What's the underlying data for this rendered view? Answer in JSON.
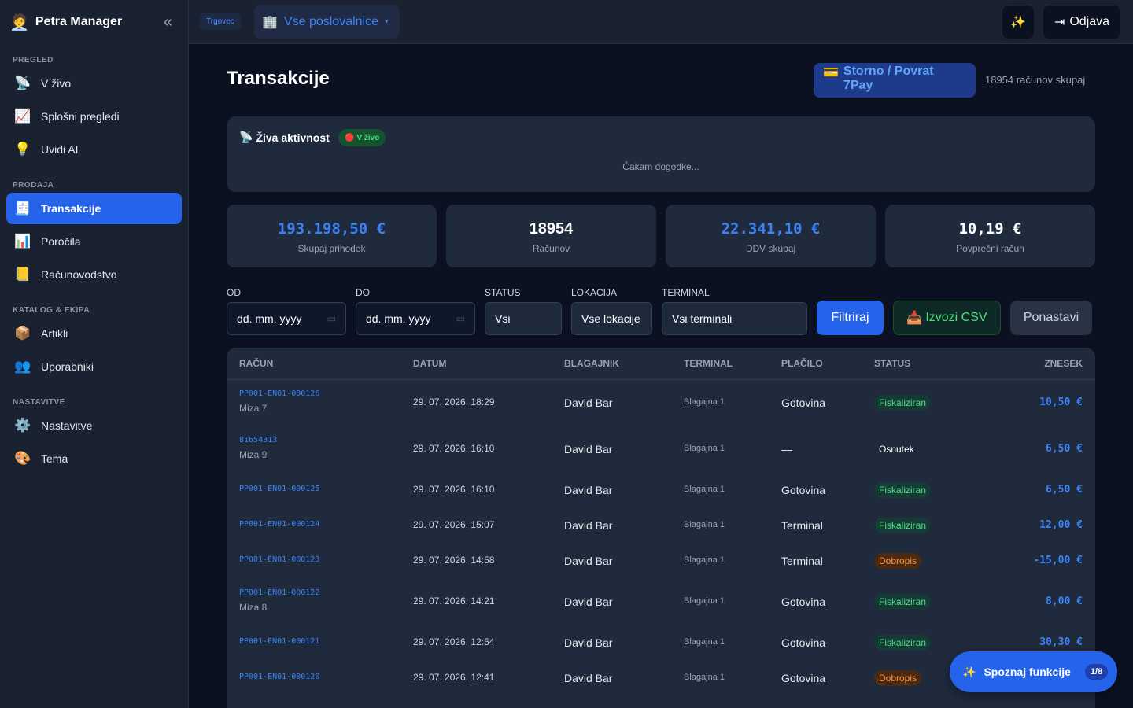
{
  "app": {
    "name": "Petra Manager",
    "logo_icon": "🧑‍💼"
  },
  "sidebar": {
    "sections": [
      {
        "title": "PREGLED",
        "items": [
          {
            "label": "V živo",
            "icon": "📡"
          },
          {
            "label": "Splošni pregledi",
            "icon": "📈"
          },
          {
            "label": "Uvidi AI",
            "icon": "💡"
          }
        ]
      },
      {
        "title": "PRODAJA",
        "items": [
          {
            "label": "Transakcije",
            "icon": "🧾",
            "active": true
          },
          {
            "label": "Poročila",
            "icon": "📊"
          },
          {
            "label": "Računovodstvo",
            "icon": "📒"
          }
        ]
      },
      {
        "title": "KATALOG & EKIPA",
        "items": [
          {
            "label": "Artikli",
            "icon": "📦"
          },
          {
            "label": "Uporabniki",
            "icon": "👥"
          }
        ]
      },
      {
        "title": "NASTAVITVE",
        "items": [
          {
            "label": "Nastavitve",
            "icon": "⚙️"
          },
          {
            "label": "Tema",
            "icon": "🎨"
          }
        ]
      }
    ]
  },
  "topbar": {
    "role": "Trgovec",
    "location": "Vse poslovalnice",
    "location_icon": "🏢",
    "logout_label": "Odjava"
  },
  "page": {
    "title": "Transakcije",
    "storno_label": "Storno / Povrat 7Pay",
    "storno_icon": "💳",
    "count_text": "18954 računov skupaj"
  },
  "live": {
    "title": "Živa aktivnost",
    "badge": "V živo",
    "waiting": "Čakam dogodke..."
  },
  "stats": [
    {
      "value": "193.198,50 €",
      "label": "Skupaj prihodek"
    },
    {
      "value": "18954",
      "label": "Računov"
    },
    {
      "value": "22.341,10 €",
      "label": "DDV skupaj"
    },
    {
      "value": "10,19 €",
      "label": "Povprečni račun"
    }
  ],
  "filters": {
    "od_label": "OD",
    "od_placeholder": "dd. mm. yyyy",
    "do_label": "DO",
    "do_placeholder": "dd. mm. yyyy",
    "status_label": "STATUS",
    "status_value": "Vsi",
    "lokacija_label": "LOKACIJA",
    "lokacija_value": "Vse lokacije",
    "terminal_label": "TERMINAL",
    "terminal_value": "Vsi terminali",
    "filter_btn": "Filtriraj",
    "csv_btn": "Izvozi CSV",
    "reset_btn": "Ponastavi"
  },
  "table": {
    "headers": [
      "RAČUN",
      "DATUM",
      "BLAGAJNIK",
      "TERMINAL",
      "PLAČILO",
      "STATUS",
      "ZNESEK"
    ],
    "rows": [
      {
        "id": "PP001-EN01-000126",
        "sub": "Miza 7",
        "date": "29. 07. 2026, 18:29",
        "cashier": "David Bar",
        "terminal": "Blagajna 1",
        "payment": "Gotovina",
        "status": "Fiskaliziran",
        "amount": "10,50 €"
      },
      {
        "id": "81654313",
        "sub": "Miza 9",
        "date": "29. 07. 2026, 16:10",
        "cashier": "David Bar",
        "terminal": "Blagajna 1",
        "payment": "—",
        "status": "Osnutek",
        "amount": "6,50 €"
      },
      {
        "id": "PP001-EN01-000125",
        "sub": "",
        "date": "29. 07. 2026, 16:10",
        "cashier": "David Bar",
        "terminal": "Blagajna 1",
        "payment": "Gotovina",
        "status": "Fiskaliziran",
        "amount": "6,50 €"
      },
      {
        "id": "PP001-EN01-000124",
        "sub": "",
        "date": "29. 07. 2026, 15:07",
        "cashier": "David Bar",
        "terminal": "Blagajna 1",
        "payment": "Terminal",
        "status": "Fiskaliziran",
        "amount": "12,00 €"
      },
      {
        "id": "PP001-EN01-000123",
        "sub": "",
        "date": "29. 07. 2026, 14:58",
        "cashier": "David Bar",
        "terminal": "Blagajna 1",
        "payment": "Terminal",
        "status": "Dobropis",
        "amount": "-15,00 €"
      },
      {
        "id": "PP001-EN01-000122",
        "sub": "Miza 8",
        "date": "29. 07. 2026, 14:21",
        "cashier": "David Bar",
        "terminal": "Blagajna 1",
        "payment": "Gotovina",
        "status": "Fiskaliziran",
        "amount": "8,00 €"
      },
      {
        "id": "PP001-EN01-000121",
        "sub": "",
        "date": "29. 07. 2026, 12:54",
        "cashier": "David Bar",
        "terminal": "Blagajna 1",
        "payment": "Gotovina",
        "status": "Fiskaliziran",
        "amount": "30,30 €"
      },
      {
        "id": "PP001-EN01-000120",
        "sub": "",
        "date": "29. 07. 2026, 12:41",
        "cashier": "David Bar",
        "terminal": "Blagajna 1",
        "payment": "Gotovina",
        "status": "Dobropis",
        "amount": ""
      }
    ]
  },
  "tour": {
    "label": "Spoznaj funkcije",
    "step": "1/8",
    "icon": "✨"
  }
}
